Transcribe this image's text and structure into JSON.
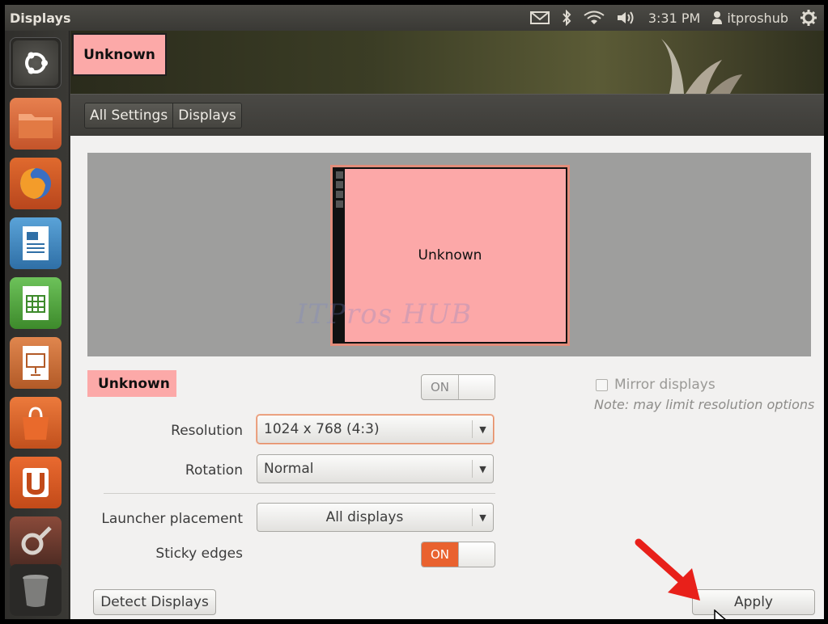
{
  "top_panel": {
    "window_title": "Displays",
    "icons": [
      "mail-icon",
      "bluetooth-icon",
      "wifi-icon",
      "volume-icon"
    ],
    "clock": "3:31 PM",
    "user": "itproshub",
    "session_icon": "gear-icon"
  },
  "launcher": {
    "items": [
      "dash-home",
      "files",
      "firefox",
      "libreoffice-writer",
      "libreoffice-calc",
      "libreoffice-impress",
      "ubuntu-software-center",
      "ubuntu-one",
      "system-settings",
      "trash"
    ]
  },
  "header": {
    "display_tab": "Unknown"
  },
  "toolbar": {
    "breadcrumb": [
      "All Settings",
      "Displays"
    ]
  },
  "preview": {
    "monitor_label": "Unknown",
    "watermark": "ITPros HUB"
  },
  "display_settings": {
    "display_name": "Unknown",
    "display_toggle": "ON",
    "resolution_label": "Resolution",
    "resolution_value": "1024 x 768 (4:3)",
    "rotation_label": "Rotation",
    "rotation_value": "Normal",
    "launcher_label": "Launcher placement",
    "launcher_value": "All displays",
    "sticky_label": "Sticky edges",
    "sticky_toggle": "ON",
    "mirror_label": "Mirror displays",
    "mirror_checked": false,
    "mirror_note": "Note: may limit resolution options"
  },
  "buttons": {
    "detect": "Detect Displays",
    "apply": "Apply"
  },
  "colors": {
    "accent": "#e9622f",
    "display_highlight": "#fca9a8",
    "annotation_arrow": "#e8201a"
  }
}
